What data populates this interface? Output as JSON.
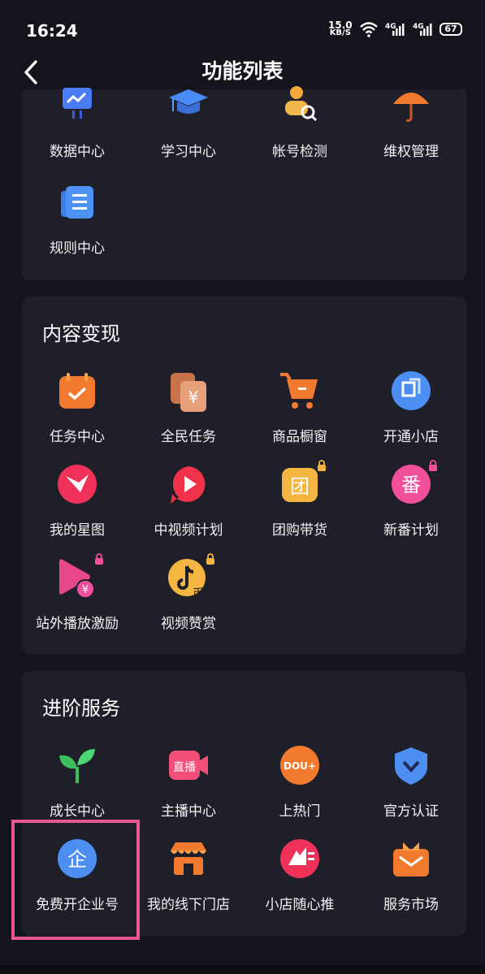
{
  "status": {
    "time": "16:24",
    "net_speed_value": "15.0",
    "net_speed_unit": "KB/S",
    "sig1": "4G",
    "sig2": "4G",
    "battery": "67"
  },
  "header": {
    "title": "功能列表"
  },
  "sections": [
    {
      "title": "",
      "items": [
        {
          "label": "数据中心",
          "icon": "presentation-chart-icon"
        },
        {
          "label": "学习中心",
          "icon": "graduation-cap-icon"
        },
        {
          "label": "帐号检测",
          "icon": "user-search-icon"
        },
        {
          "label": "维权管理",
          "icon": "umbrella-icon"
        },
        {
          "label": "规则中心",
          "icon": "document-list-icon"
        }
      ]
    },
    {
      "title": "内容变现",
      "items": [
        {
          "label": "任务中心",
          "icon": "calendar-check-icon"
        },
        {
          "label": "全民任务",
          "icon": "yuan-cards-icon"
        },
        {
          "label": "商品橱窗",
          "icon": "shopping-cart-icon"
        },
        {
          "label": "开通小店",
          "icon": "store-d-icon"
        },
        {
          "label": "我的星图",
          "icon": "star-map-icon"
        },
        {
          "label": "中视频计划",
          "icon": "play-bubble-icon"
        },
        {
          "label": "团购带货",
          "icon": "group-buy-icon",
          "locked": true
        },
        {
          "label": "新番计划",
          "icon": "fan-icon",
          "locked": true
        },
        {
          "label": "站外播放激励",
          "icon": "play-yuan-icon",
          "locked": true
        },
        {
          "label": "视频赞赏",
          "icon": "tiktok-coin-icon",
          "locked": true
        }
      ]
    },
    {
      "title": "进阶服务",
      "items": [
        {
          "label": "成长中心",
          "icon": "sprout-icon"
        },
        {
          "label": "主播中心",
          "icon": "live-camera-icon",
          "badge": "直播"
        },
        {
          "label": "上热门",
          "icon": "dou-plus-icon",
          "badge": "DOU+"
        },
        {
          "label": "官方认证",
          "icon": "shield-check-icon"
        },
        {
          "label": "免费开企业号",
          "icon": "enterprise-icon",
          "badge": "企"
        },
        {
          "label": "我的线下门店",
          "icon": "storefront-icon"
        },
        {
          "label": "小店随心推",
          "icon": "promote-icon"
        },
        {
          "label": "服务市场",
          "icon": "service-bag-icon"
        }
      ]
    }
  ],
  "colors": {
    "background": "#14141c",
    "card": "#1f1f2a",
    "highlight": "#e8578d"
  }
}
